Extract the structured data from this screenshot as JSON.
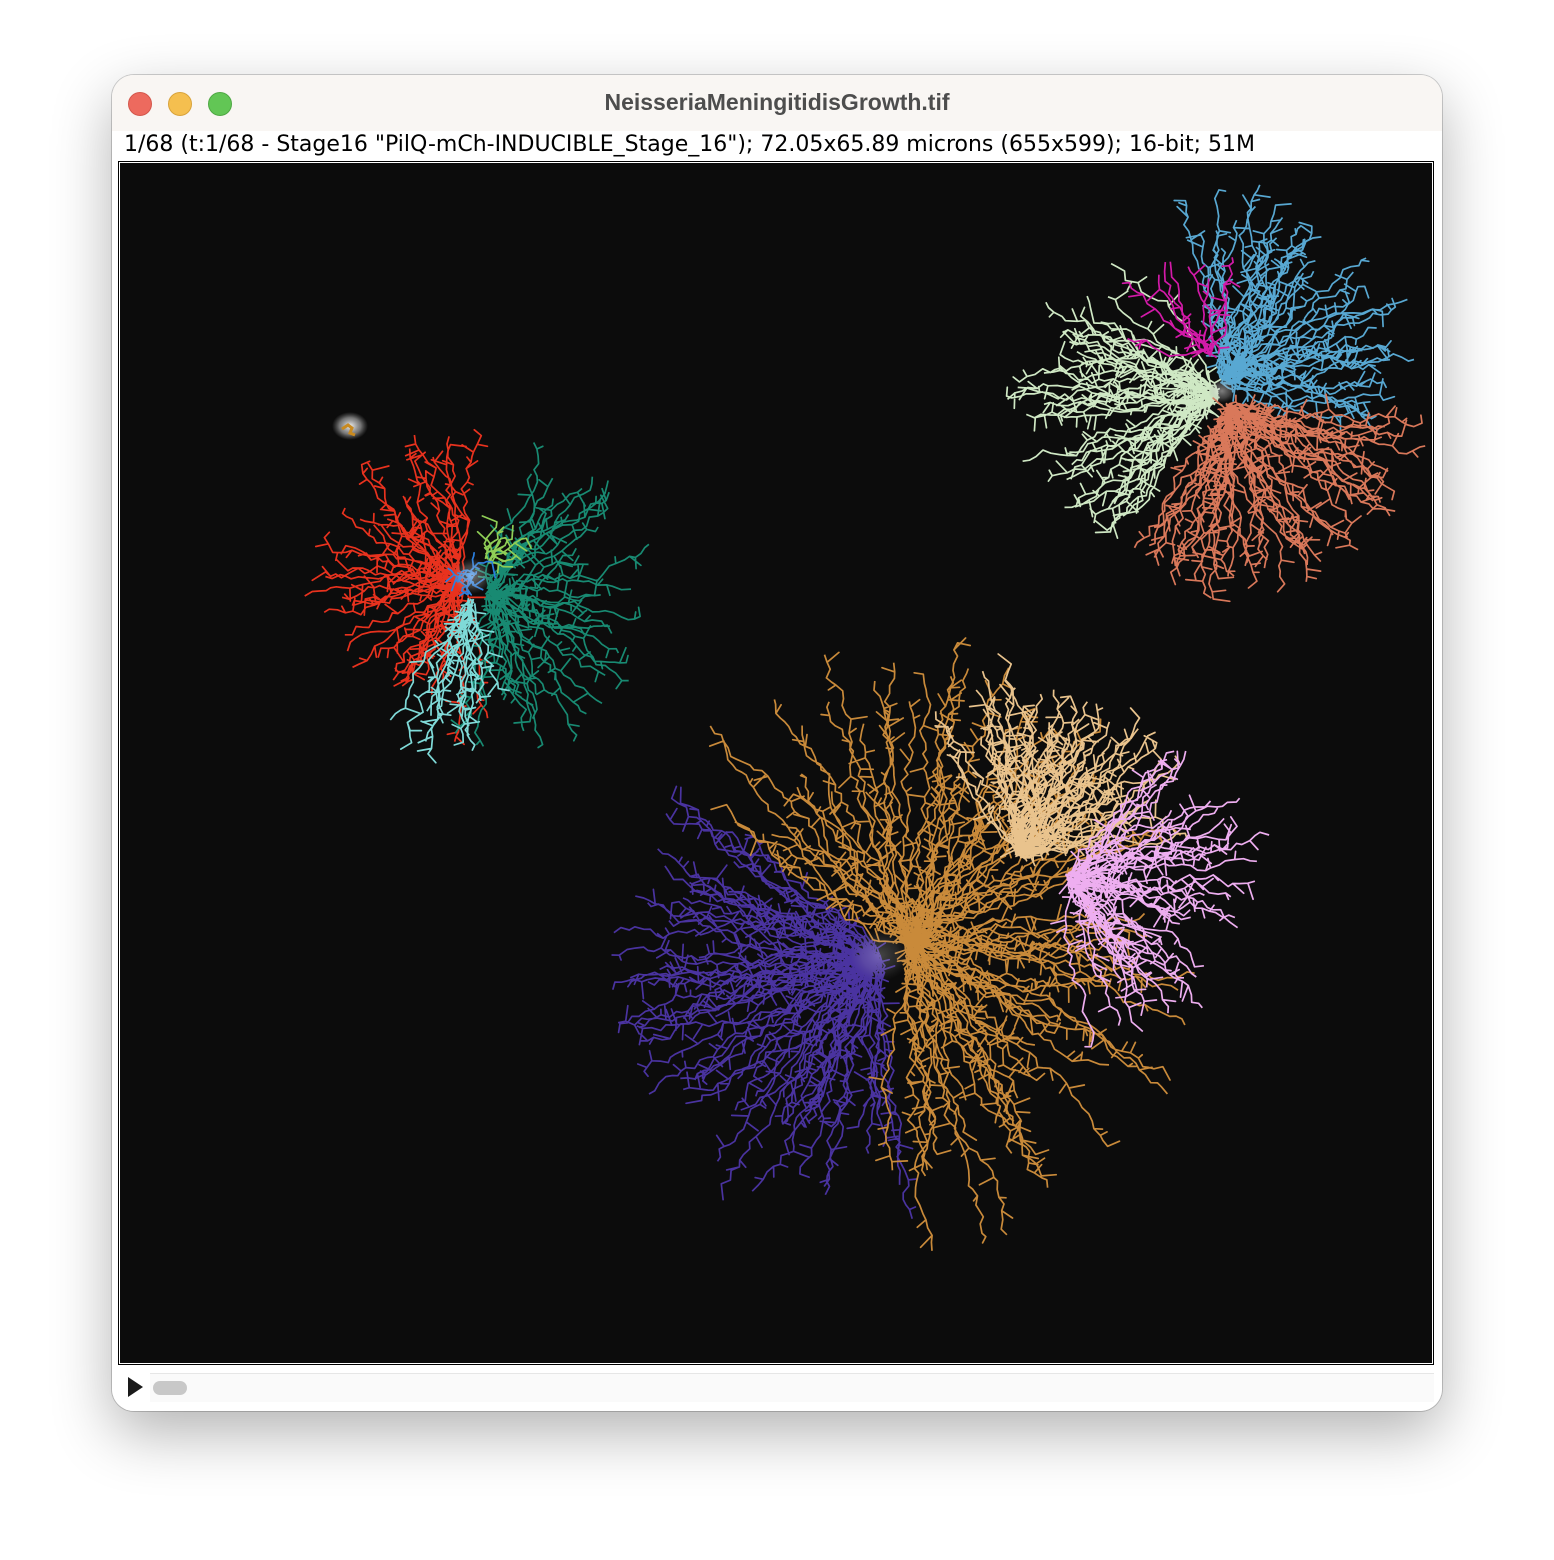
{
  "window": {
    "title": "NeisseriaMeningitidisGrowth.tif",
    "info": "1/68 (t:1/68 - Stage16 \"PilQ-mCh-INDUCIBLE_Stage_16\"); 72.05x65.89 microns (655x599); 16-bit; 51M"
  },
  "traffic_lights": [
    "close",
    "minimize",
    "zoom"
  ],
  "image": {
    "background_color": "#0c0c0c",
    "colonies": [
      {
        "name": "colony-left",
        "clusters": [
          {
            "color": "#e8321e",
            "rays": 48
          },
          {
            "color": "#188a72",
            "rays": 40
          },
          {
            "color": "#7fdad8",
            "rays": 14
          },
          {
            "color": "#8fce56",
            "rays": 10
          },
          {
            "color": "#2a7fe0",
            "rays": 10
          }
        ]
      },
      {
        "name": "colony-top-right",
        "clusters": [
          {
            "color": "#cfe8c4",
            "rays": 42
          },
          {
            "color": "#58a8d2",
            "rays": 44
          },
          {
            "color": "#d9785a",
            "rays": 48
          },
          {
            "color": "#d21aa8",
            "rays": 10
          }
        ]
      },
      {
        "name": "colony-bottom",
        "clusters": [
          {
            "color": "#4a33a0",
            "rays": 70
          },
          {
            "color": "#c98a3a",
            "rays": 90
          },
          {
            "color": "#e9c38d",
            "rays": 56
          },
          {
            "color": "#eeaef0",
            "rays": 46
          }
        ]
      }
    ]
  },
  "playback": {
    "play_icon": "play-icon"
  }
}
